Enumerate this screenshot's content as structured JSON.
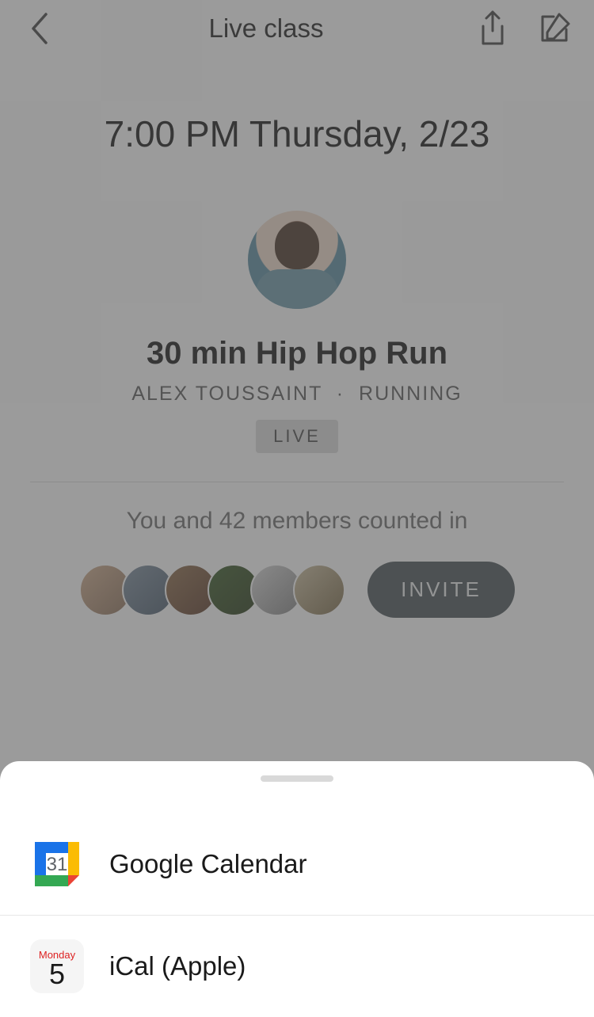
{
  "header": {
    "title": "Live class"
  },
  "class": {
    "datetime": "7:00 PM Thursday, 2/23",
    "title": "30 min Hip Hop Run",
    "instructor": "ALEX TOUSSAINT",
    "category": "RUNNING",
    "live_badge": "LIVE"
  },
  "members": {
    "text": "You and 42 members counted in",
    "invite_label": "INVITE"
  },
  "sheet": {
    "items": [
      {
        "label": "Google Calendar",
        "icon": "google-calendar"
      },
      {
        "label": "iCal (Apple)",
        "icon": "ical"
      }
    ],
    "ical_day": "Monday",
    "ical_num": "5",
    "gcal_num": "31"
  }
}
